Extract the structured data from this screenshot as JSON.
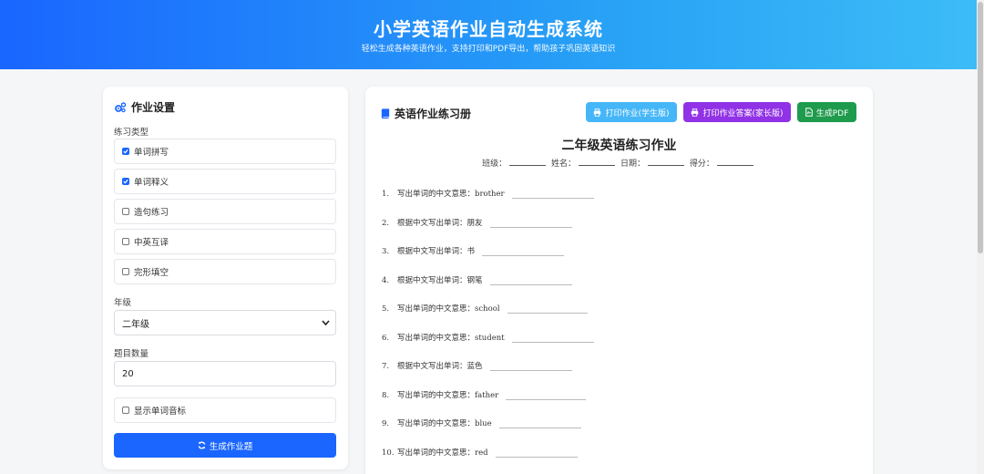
{
  "header": {
    "title": "小学英语作业自动生成系统",
    "subtitle": "轻松生成各种英语作业，支持打印和PDF导出，帮助孩子巩固英语知识"
  },
  "settings": {
    "title": "作业设置",
    "exercise_type_label": "练习类型",
    "options": [
      {
        "label": "单词拼写",
        "checked": true
      },
      {
        "label": "单词释义",
        "checked": true
      },
      {
        "label": "造句练习",
        "checked": false
      },
      {
        "label": "中英互译",
        "checked": false
      },
      {
        "label": "完形填空",
        "checked": false
      }
    ],
    "grade_label": "年级",
    "grade_value": "二年级",
    "count_label": "题目数量",
    "count_value": "20",
    "phonetic_label": "显示单词音标",
    "phonetic_checked": false,
    "generate_label": "生成作业题"
  },
  "workbook": {
    "title": "英语作业练习册",
    "buttons": {
      "print_student": "打印作业(学生版)",
      "print_answer": "打印作业答案(家长版)",
      "pdf": "生成PDF"
    },
    "sheet_title": "二年级英语练习作业",
    "info": {
      "class_label": "班级：",
      "name_label": "姓名：",
      "date_label": "日期：",
      "score_label": "得分："
    },
    "questions": [
      {
        "num": "1.",
        "text": "写出单词的中文意思：brother"
      },
      {
        "num": "2.",
        "text": "根据中文写出单词：朋友"
      },
      {
        "num": "3.",
        "text": "根据中文写出单词：书"
      },
      {
        "num": "4.",
        "text": "根据中文写出单词：钢笔"
      },
      {
        "num": "5.",
        "text": "写出单词的中文意思：school"
      },
      {
        "num": "6.",
        "text": "写出单词的中文意思：student"
      },
      {
        "num": "7.",
        "text": "根据中文写出单词：蓝色"
      },
      {
        "num": "8.",
        "text": "写出单词的中文意思：father"
      },
      {
        "num": "9.",
        "text": "写出单词的中文意思：blue"
      },
      {
        "num": "10.",
        "text": "写出单词的中文意思：red"
      }
    ]
  },
  "colors": {
    "primary": "#1a66ff",
    "print_student": "#45b6f7",
    "print_answer": "#9132e6",
    "pdf": "#1e9b4d"
  }
}
